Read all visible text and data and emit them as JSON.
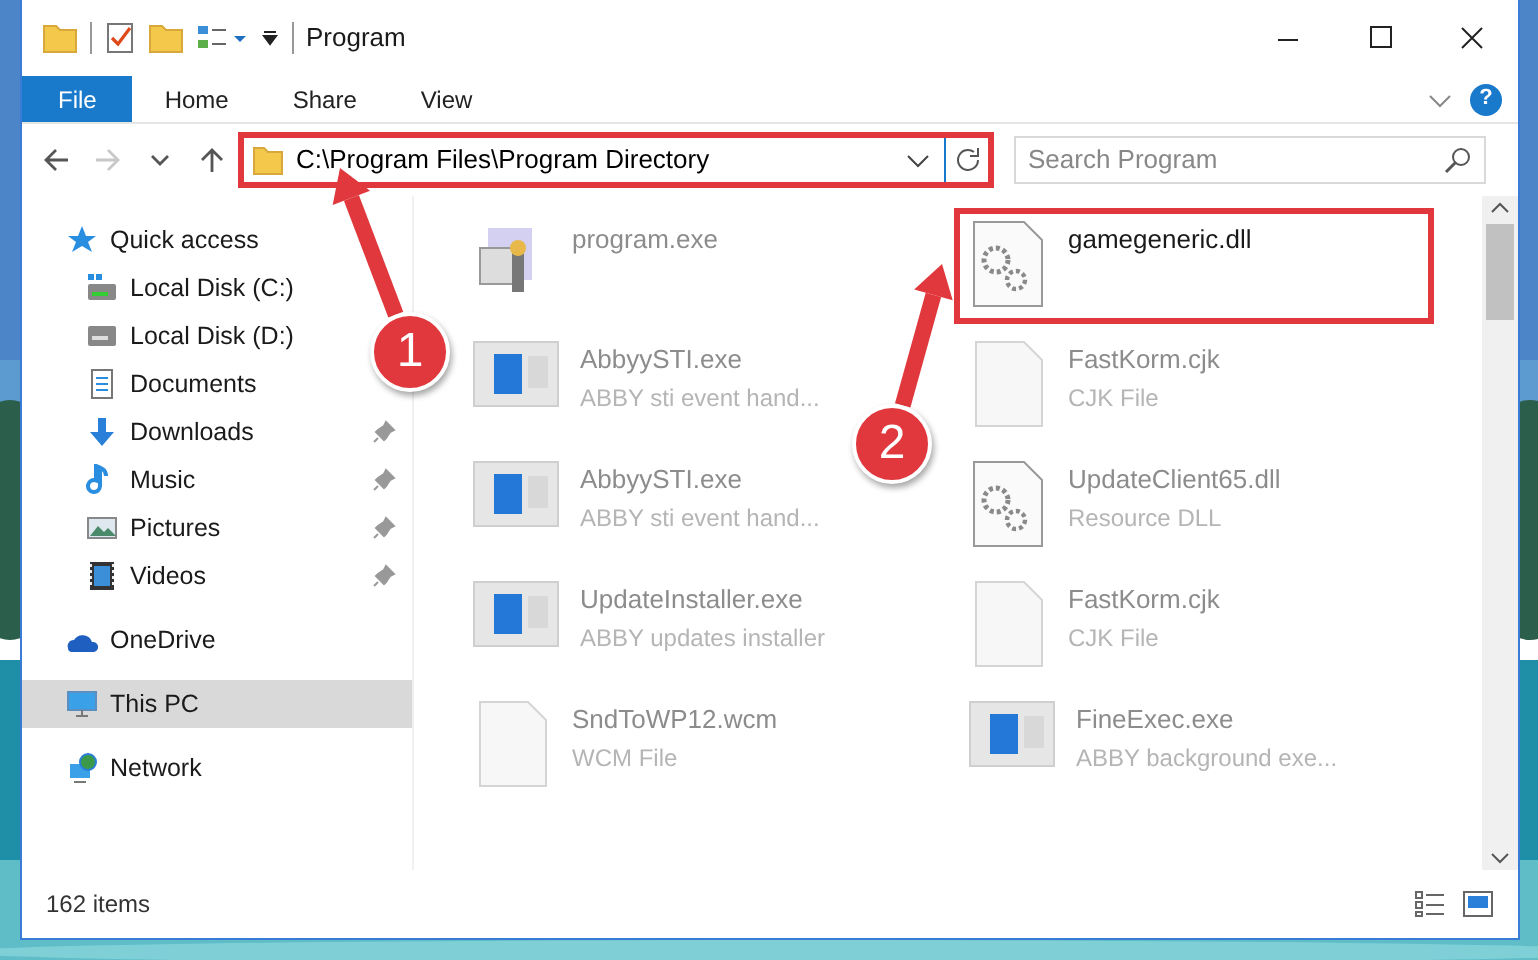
{
  "window": {
    "title": "Program"
  },
  "ribbon": {
    "tabs": [
      {
        "label": "File",
        "selected": true
      },
      {
        "label": "Home",
        "selected": false
      },
      {
        "label": "Share",
        "selected": false
      },
      {
        "label": "View",
        "selected": false
      }
    ],
    "help": "?"
  },
  "navigation": {
    "back": {
      "disabled": false
    },
    "forward": {
      "disabled": true
    }
  },
  "address": {
    "path": "C:\\Program Files\\Program Directory",
    "highlighted": true
  },
  "search": {
    "placeholder": "Search Program"
  },
  "sidebar": {
    "items": [
      {
        "label": "Quick access",
        "selected": false,
        "children": [
          {
            "label": "Local Disk (C:)",
            "pinned": false
          },
          {
            "label": "Local Disk (D:)",
            "pinned": false
          },
          {
            "label": "Documents",
            "pinned": false
          },
          {
            "label": "Downloads",
            "pinned": true
          },
          {
            "label": "Music",
            "pinned": true
          },
          {
            "label": "Pictures",
            "pinned": true
          },
          {
            "label": "Videos",
            "pinned": true
          }
        ]
      },
      {
        "label": "OneDrive",
        "selected": false
      },
      {
        "label": "This PC",
        "selected": true
      },
      {
        "label": "Network",
        "selected": false
      }
    ]
  },
  "files": [
    {
      "name": "program.exe",
      "kind": "program",
      "highlighted": false
    },
    {
      "name": "gamegeneric.dll",
      "kind": "dll",
      "highlighted": true
    },
    {
      "name": "AbbyySTI.exe",
      "type": "ABBY sti event hand...",
      "kind": "app",
      "highlighted": false
    },
    {
      "name": "FastKorm.cjk",
      "type": "CJK File",
      "kind": "doc",
      "highlighted": false
    },
    {
      "name": "AbbyySTI.exe",
      "type": "ABBY sti event hand...",
      "kind": "app",
      "highlighted": false
    },
    {
      "name": "UpdateClient65.dll",
      "type": "Resource DLL",
      "kind": "dll",
      "highlighted": false
    },
    {
      "name": "UpdateInstaller.exe",
      "type": "ABBY updates installer",
      "kind": "app",
      "highlighted": false
    },
    {
      "name": "FastKorm.cjk",
      "type": "CJK File",
      "kind": "doc",
      "highlighted": false
    },
    {
      "name": "SndToWP12.wcm",
      "type": "WCM File",
      "kind": "doc",
      "highlighted": false
    },
    {
      "name": "FineExec.exe",
      "type": "ABBY background exe...",
      "kind": "app",
      "highlighted": false
    }
  ],
  "status_bar": {
    "item_count": "162 items"
  },
  "callouts": [
    {
      "number": "1"
    },
    {
      "number": "2"
    }
  ]
}
